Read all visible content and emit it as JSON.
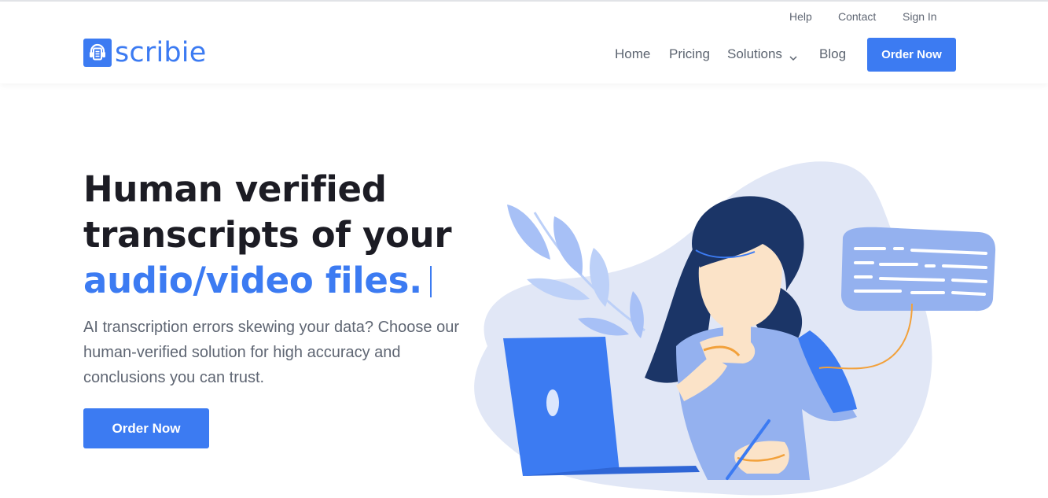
{
  "brand": {
    "name": "scribie",
    "color": "#3c7bf2",
    "icon": "headphones-document-icon"
  },
  "utility_nav": {
    "help": "Help",
    "contact": "Contact",
    "sign_in": "Sign In"
  },
  "main_nav": {
    "home": "Home",
    "pricing": "Pricing",
    "solutions": "Solutions",
    "blog": "Blog",
    "order_now": "Order Now"
  },
  "hero": {
    "title_line1": "Human verified",
    "title_line2": "transcripts of your",
    "title_accent": "audio/video files.",
    "description": "AI transcription errors skewing your data? Choose our human-verified solution for high accuracy and conclusions you can trust.",
    "cta": "Order Now"
  },
  "illustration": {
    "subject": "woman-at-laptop-illustration",
    "speech_bubble": "speech-bubble-icon",
    "plant": "leaf-plant-icon"
  },
  "colors": {
    "accent": "#3c7bf2",
    "highlight": "#fbe3cf",
    "blob": "#e1e7f6",
    "bubble": "#94b1ef",
    "hair": "#1b3567",
    "skin": "#fbe3c8",
    "shirt": "#94b1ef",
    "orange": "#f2a13b"
  }
}
